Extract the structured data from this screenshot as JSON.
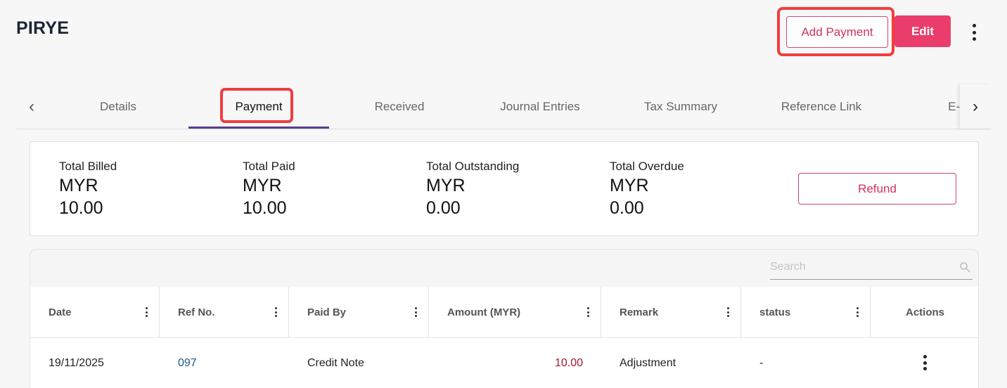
{
  "header": {
    "title": "PIRYE",
    "add_payment_label": "Add Payment",
    "edit_label": "Edit"
  },
  "tabs": [
    {
      "label": "Details"
    },
    {
      "label": "Payment",
      "active": true
    },
    {
      "label": "Received"
    },
    {
      "label": "Journal Entries"
    },
    {
      "label": "Tax Summary"
    },
    {
      "label": "Reference Link"
    },
    {
      "label": "E-Inv"
    }
  ],
  "summary": {
    "stats": [
      {
        "label": "Total Billed",
        "currency": "MYR",
        "value": "10.00"
      },
      {
        "label": "Total Paid",
        "currency": "MYR",
        "value": "10.00"
      },
      {
        "label": "Total Outstanding",
        "currency": "MYR",
        "value": "0.00"
      },
      {
        "label": "Total Overdue",
        "currency": "MYR",
        "value": "0.00"
      }
    ],
    "refund_label": "Refund"
  },
  "search": {
    "placeholder": "Search",
    "value": ""
  },
  "table": {
    "columns": [
      "Date",
      "Ref No.",
      "Paid By",
      "Amount (MYR)",
      "Remark",
      "status",
      "Actions"
    ],
    "rows": [
      {
        "date": "19/11/2025",
        "ref": "097",
        "paid_by": "Credit Note",
        "amount": "10.00",
        "remark": "Adjustment",
        "status": "-"
      }
    ]
  },
  "colors": {
    "accent": "#ea3d6b",
    "tab_underline": "#5b3b8f",
    "highlight": "#ef3e3e",
    "link": "#1e5a8a",
    "amount": "#a8192e"
  }
}
